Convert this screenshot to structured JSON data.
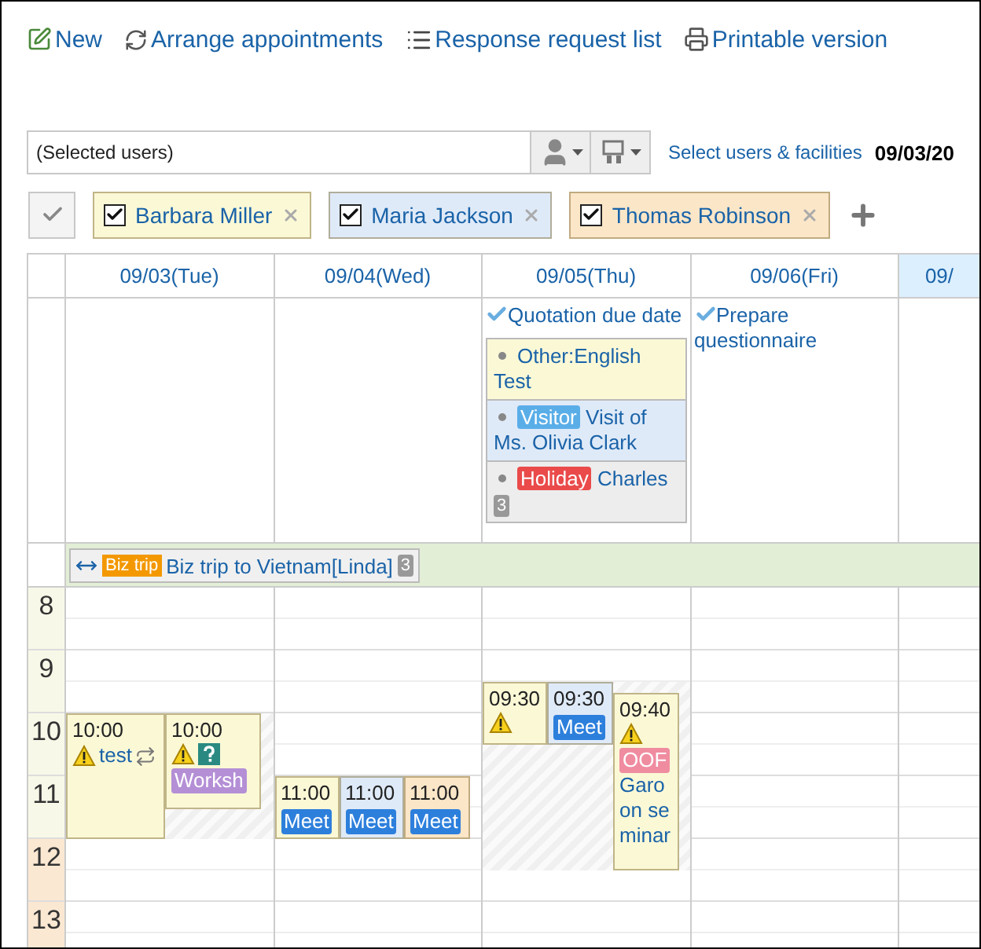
{
  "toolbar": [
    {
      "label": "New",
      "kind": "new"
    },
    {
      "label": "Arrange appointments",
      "kind": "arrange"
    },
    {
      "label": "Response request list",
      "kind": "list"
    },
    {
      "label": "Printable version",
      "kind": "print"
    }
  ],
  "search": {
    "value": "(Selected users)",
    "link": "Select users & facilities",
    "date": "09/03/20"
  },
  "users": [
    {
      "name": "Barbara Miller",
      "checked": true,
      "color": "#fbf8d6"
    },
    {
      "name": "Maria Jackson",
      "checked": true,
      "color": "#dfeaf8"
    },
    {
      "name": "Thomas Robinson",
      "checked": true,
      "color": "#fbe6c8"
    }
  ],
  "days": [
    {
      "label": "09/03(Tue)",
      "today": false,
      "events": [
        {
          "time": "10:00",
          "color": "#fbf8d6",
          "conflict": true,
          "unconfirmed": false,
          "repeat": true,
          "title": "test"
        },
        {
          "time": "10:00",
          "color": "#fbf8d6",
          "conflict": true,
          "unconfirmed": true,
          "repeat": false,
          "tag": {
            "label": "Worksh",
            "color": "#b48fd6"
          }
        }
      ]
    },
    {
      "label": "09/04(Wed)",
      "today": false,
      "events": [
        {
          "time": "11:00",
          "color": "#fbf8d6",
          "conflict": false,
          "unconfirmed": false,
          "repeat": false,
          "tag": {
            "label": "Meet",
            "color": "#2d7fdc"
          }
        },
        {
          "time": "11:00",
          "color": "#dfeaf8",
          "conflict": false,
          "unconfirmed": false,
          "repeat": false,
          "tag": {
            "label": "Meet",
            "color": "#2d7fdc"
          }
        },
        {
          "time": "11:00",
          "color": "#fbe6c8",
          "conflict": false,
          "unconfirmed": false,
          "repeat": false,
          "tag": {
            "label": "Meet",
            "color": "#2d7fdc"
          }
        }
      ]
    },
    {
      "label": "09/05(Thu)",
      "today": false,
      "tasks": [
        "Quotation due date"
      ],
      "items": [
        {
          "text": "Other:English Test",
          "color": "#fbf8d6"
        },
        {
          "text": "Visit of Ms. Olivia Clark",
          "color": "#dfeaf8",
          "tag": {
            "label": "Visitor",
            "color": "#5aaee8"
          }
        },
        {
          "text": "Charles",
          "color": "#ededed",
          "tag": {
            "label": "Holiday",
            "color": "#ea4a4a"
          },
          "count": "3"
        }
      ],
      "events": [
        {
          "time": "09:30",
          "color": "#fbf8d6",
          "conflict": true,
          "unconfirmed": false,
          "repeat": false
        },
        {
          "time": "09:30",
          "color": "#dfeaf8",
          "conflict": false,
          "unconfirmed": false,
          "repeat": false,
          "tag": {
            "label": "Meet",
            "color": "#2d7fdc"
          }
        },
        {
          "time": "09:40",
          "color": "#fbf8d6",
          "conflict": true,
          "unconfirmed": false,
          "repeat": false,
          "tag": {
            "label": "OOF",
            "color": "#f08ca0"
          },
          "title": "Garoon seminar"
        }
      ]
    },
    {
      "label": "09/06(Fri)",
      "today": false,
      "tasks": [
        "Prepare questionnaire"
      ]
    },
    {
      "label": "09/",
      "today": true
    }
  ],
  "trip": {
    "tag": "Biz trip",
    "title": "Biz trip to Vietnam[Linda]",
    "count": "3"
  },
  "hours": [
    {
      "label": "8",
      "color": "#f8f8e8"
    },
    {
      "label": "9",
      "color": "#f8f8e8"
    },
    {
      "label": "10",
      "color": "#f8f8e8"
    },
    {
      "label": "11",
      "color": "#f8f8e8"
    },
    {
      "label": "12",
      "color": "#fbe8d2"
    },
    {
      "label": "13",
      "color": "#fbe8d2"
    }
  ]
}
